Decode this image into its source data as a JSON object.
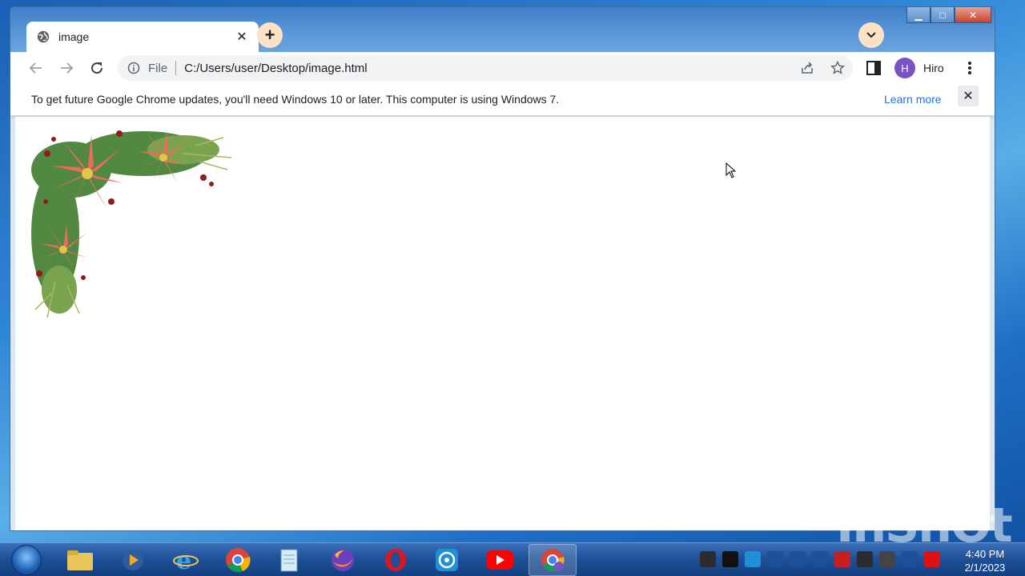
{
  "tab": {
    "title": "image",
    "close_glyph": "✕"
  },
  "toolbar": {
    "scheme_label": "File",
    "url": "C:/Users/user/Desktop/image.html"
  },
  "profile": {
    "initial": "H",
    "name": "Hiro"
  },
  "infobar": {
    "message": "To get future Google Chrome updates, you'll need Windows 10 or later. This computer is using Windows 7.",
    "link": "Learn more",
    "dismiss_glyph": "✕"
  },
  "window_controls": {
    "minimize": "▁",
    "maximize": "□",
    "close": "✕"
  },
  "new_tab_glyph": "+",
  "taskbar": {
    "apps": [
      "file-explorer",
      "media-player",
      "internet-explorer",
      "chrome",
      "notepad",
      "firefox",
      "opera",
      "screen-recorder",
      "youtube",
      "chrome-profile"
    ],
    "clock_time": "4:40 PM",
    "clock_date": "2/1/2023"
  },
  "watermark": "InShOt",
  "colors": {
    "accent": "#1a73e8",
    "avatar": "#7b52c2",
    "newtab_bg": "#fde2c5"
  }
}
